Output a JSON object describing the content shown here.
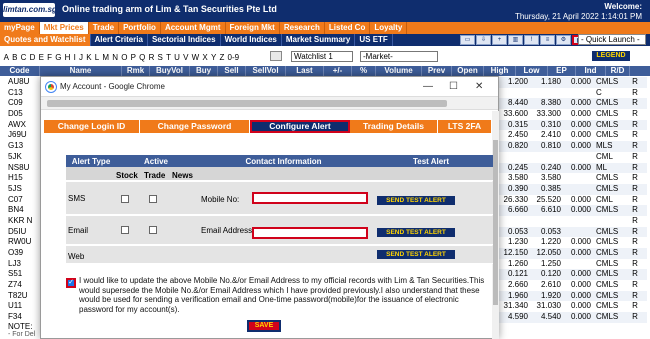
{
  "header": {
    "logo": "limtan.com.sg",
    "tagline": "Online trading arm of Lim & Tan Securities Pte Ltd",
    "welcome": "Welcome:",
    "datetime": "Thursday, 21 April 2022 1:14:01 PM"
  },
  "nav": [
    "myPage",
    "Mkt Prices",
    "Trade",
    "Portfolio",
    "Account Mgmt",
    "Foreign Mkt",
    "Research",
    "Listed Co",
    "Loyalty"
  ],
  "subnav": [
    "Quotes and Watchlist",
    "Alert Criteria",
    "Sectorial Indices",
    "World Indices",
    "Market Summary",
    "US ETF"
  ],
  "quick_launch": "- Quick Launch -",
  "alphabet": [
    "A",
    "B",
    "C",
    "D",
    "E",
    "F",
    "G",
    "H",
    "I",
    "J",
    "K",
    "L",
    "M",
    "N",
    "O",
    "P",
    "Q",
    "R",
    "S",
    "T",
    "U",
    "V",
    "W",
    "X",
    "Y",
    "Z",
    "0-9"
  ],
  "watchlist_select": "Watchlist 1",
  "market_select": "-Market-",
  "legend_label": "LEGEND",
  "table_headers": [
    "Code",
    "Name",
    "Rmk",
    "BuyVol",
    "Buy",
    "Sell",
    "SellVol",
    "Last",
    "+/-",
    "%",
    "Volume",
    "Prev",
    "Open",
    "High",
    "Low",
    "EP",
    "Ind",
    "R/D"
  ],
  "codes": [
    "AU8U",
    "C13",
    "C09",
    "D05",
    "AWX",
    "J69U",
    "G13",
    "5JK",
    "NS8U",
    "H15",
    "5JS",
    "C07",
    "BN4",
    "KKR N",
    "D5IU",
    "RW0U",
    "O39",
    "LJ3",
    "S51",
    "Z74",
    "T82U",
    "U11",
    "F34"
  ],
  "right_rows": [
    [
      "1.200",
      "1.180",
      "0.000",
      "CMLS",
      "R"
    ],
    [
      "",
      "",
      "",
      "C",
      "R"
    ],
    [
      "8.440",
      "8.380",
      "0.000",
      "CMLS",
      "R"
    ],
    [
      "33.600",
      "33.300",
      "0.000",
      "CMLS",
      "R"
    ],
    [
      "0.315",
      "0.310",
      "0.000",
      "CMLS",
      "R"
    ],
    [
      "2.450",
      "2.410",
      "0.000",
      "CMLS",
      "R"
    ],
    [
      "0.820",
      "0.810",
      "0.000",
      "MLS",
      "R"
    ],
    [
      "",
      "",
      "",
      "CML",
      "R"
    ],
    [
      "0.245",
      "0.240",
      "0.000",
      "ML",
      "R"
    ],
    [
      "3.580",
      "3.580",
      "",
      "CMLS",
      "R"
    ],
    [
      "0.390",
      "0.385",
      "",
      "CMLS",
      "R"
    ],
    [
      "26.330",
      "25.520",
      "0.000",
      "CML",
      "R"
    ],
    [
      "6.660",
      "6.610",
      "0.000",
      "CMLS",
      "R"
    ],
    [
      "",
      "",
      "",
      "",
      "R"
    ],
    [
      "0.053",
      "0.053",
      "",
      "CMLS",
      "R"
    ],
    [
      "1.230",
      "1.220",
      "0.000",
      "CMLS",
      "R"
    ],
    [
      "12.150",
      "12.050",
      "0.000",
      "CMLS",
      "R"
    ],
    [
      "1.260",
      "1.250",
      "",
      "CMLS",
      "R"
    ],
    [
      "0.121",
      "0.120",
      "0.000",
      "CMLS",
      "R"
    ],
    [
      "2.660",
      "2.610",
      "0.000",
      "CMLS",
      "R"
    ],
    [
      "1.960",
      "1.920",
      "0.000",
      "CMLS",
      "R"
    ],
    [
      "31.340",
      "31.030",
      "0.000",
      "CMLS",
      "R"
    ],
    [
      "4.590",
      "4.540",
      "0.000",
      "CMLS",
      "R"
    ]
  ],
  "note": "NOTE:",
  "note_sub": "- For Del",
  "dialog": {
    "title": "My Account - Google Chrome",
    "tabs": [
      "Change Login ID",
      "Change Password",
      "Configure Alert",
      "Trading Details",
      "LTS 2FA"
    ],
    "alert_table": {
      "headers": [
        "Alert Type",
        "Active",
        "Contact Information",
        "Test Alert"
      ],
      "subheaders": [
        "Stock",
        "Trade",
        "News"
      ],
      "rows": [
        {
          "type": "SMS",
          "field_label": "Mobile No:",
          "button": "SEND TEST ALERT"
        },
        {
          "type": "Email",
          "field_label": "Email Address:",
          "button": "SEND TEST ALERT"
        },
        {
          "type": "Web",
          "field_label": "",
          "button": "SEND TEST ALERT"
        }
      ]
    },
    "consent_text": "I would like to update the above Mobile No.&/or Email Address to my official records with Lim & Tan Securities.This would supersede the Mobile No.&/or Email Address which I have provided previously.I also understand that these would be used for sending a verification email and One-time password(mobile)for the issuance of electronic password for my account(s).",
    "save_label": "SAVE"
  },
  "colors": {
    "navy": "#0f2d6e",
    "orange": "#f07a1a",
    "red": "#d0021b",
    "yellow": "#ffd400"
  }
}
